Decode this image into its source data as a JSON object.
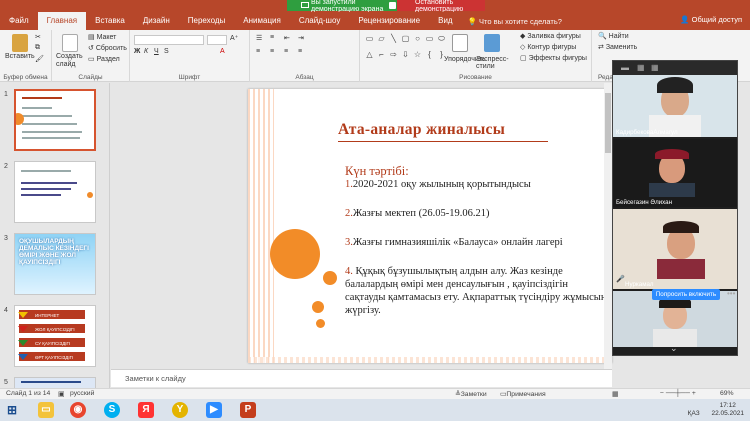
{
  "titlebar": {
    "share_status": "Вы запустили демонстрацию экрана",
    "stop_share": "Остановить демонстрацию"
  },
  "tabs": [
    {
      "label": "Файл"
    },
    {
      "label": "Главная"
    },
    {
      "label": "Вставка"
    },
    {
      "label": "Дизайн"
    },
    {
      "label": "Переходы"
    },
    {
      "label": "Анимация"
    },
    {
      "label": "Слайд-шоу"
    },
    {
      "label": "Рецензирование"
    },
    {
      "label": "Вид"
    }
  ],
  "tell_me": "Что вы хотите сделать?",
  "account": "Общий доступ",
  "ribbon": {
    "paste": "Вставить",
    "new_slide": "Создать слайд",
    "layout": "Макет",
    "reset": "Сбросить",
    "section": "Раздел",
    "arrange": "Упорядочить",
    "quick_styles": "Экспресс-стили",
    "fill": "Заливка фигуры",
    "outline": "Контур фигуры",
    "effects": "Эффекты фигуры",
    "find": "Найти",
    "replace": "Заменить",
    "select": "Выделить",
    "groups": [
      "Буфер обмена",
      "Слайды",
      "Шрифт",
      "Абзац",
      "Рисование",
      "Редакт"
    ]
  },
  "thumbnails": {
    "numbers": [
      "1",
      "2",
      "3",
      "4",
      "5"
    ],
    "slide3_text": "ОҚУШЫЛАРДЫҢ ДЕМАЛЫС КЕЗІНДЕГІ ӨМІРІ ЖӘНЕ ЖОЛ ҚАУІПСІЗДІГІ",
    "slide4_rows": [
      "ИНТЕРНЕТ ҚАУІПСІЗДІГІ",
      "ЖОЛ ҚАУІПСІЗДІГІ",
      "СУ ҚАУІПСІЗДІГІ",
      "ӨРТ ҚАУІПСІЗДІГІ"
    ]
  },
  "slide": {
    "title": "Ата-аналар жиналысы",
    "agenda": "Күн тәртібі:",
    "items": [
      {
        "num": "1.",
        "text": "2020-2021 оқу жылының қорытындысы"
      },
      {
        "num": "2.",
        "text": "Жазғы мектеп (26.05-19.06.21)"
      },
      {
        "num": "3.",
        "text": "Жазғы гимназияшілік «Балауса» онлайн лагері"
      },
      {
        "num": "4.",
        "text": " Құқық бұзушылықтың алдын алу. Жаз кезінде балалардың өмірі мен денсаулығын , қауіпсіздігін сақтауды қамтамасыз ету. Ақпараттық түсіндіру жұмысын жүргізу."
      }
    ]
  },
  "notes_placeholder": "Заметки к слайду",
  "status": {
    "slide_of": "Слайд 1 из 14",
    "language": "русский",
    "notes": "Заметки",
    "comments": "Примечания",
    "zoom": "69%"
  },
  "zoom_panel": {
    "participants": [
      "КадирбековаАлмагул",
      "Бейсегазин Әлихан",
      "Нуркамал",
      ""
    ],
    "unmute_label": "Попросить включить"
  },
  "tray": {
    "lang": "ҚАЗ",
    "time": "17:12",
    "date": "22.05.2021"
  },
  "colors": {
    "accent": "#b7472a",
    "orange": "#f28c28",
    "title": "#b23b1a"
  }
}
